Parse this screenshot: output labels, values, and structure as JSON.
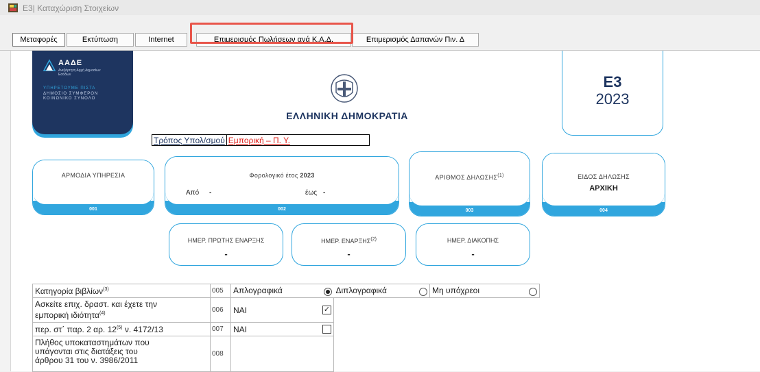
{
  "window": {
    "title": "Ε3| Καταχώριση Στοιχείων"
  },
  "toolbar": {
    "buttons": [
      "Μεταφορές",
      "Εκτύπωση",
      "Internet",
      "Επιμερισμός Πωλήσεων ανά Κ.Α.Δ.",
      "Επιμερισμός Δαπανών Πιν. Δ"
    ]
  },
  "logo": {
    "brand": "ΑΑΔΕ",
    "brand_sub": "Ανεξάρτητη Αρχή Δημοσίων Εσόδων",
    "motto_1": "ΥΠΗΡΕΤΟΥΜΕ ΠΙΣΤΑ",
    "motto_2": "ΔΗΜΟΣΙΟ ΣΥΜΦΕΡΟΝ ΚΟΙΝΩΝΙΚΟ ΣΥΝΟΛΟ"
  },
  "header": {
    "republic": "ΕΛΛΗΝΙΚΗ ΔΗΜΟΚΡΑΤΙΑ",
    "form": "Ε3",
    "year": "2023"
  },
  "calc": {
    "label": "Τρόπος Υπολ/σμού",
    "value": "Εμπορική – Π. Υ."
  },
  "fields": {
    "service": {
      "title": "ΑΡΜΟΔΙΑ ΥΠΗΡΕΣΙΑ",
      "code": "001"
    },
    "tax_year": {
      "title_prefix": "Φορολογικό έτος",
      "year": "2023",
      "from_label": "Από",
      "from_value": "-",
      "to_label": "έως",
      "to_value": "-",
      "code": "002"
    },
    "decl_no": {
      "title": "ΑΡΙΘΜΟΣ ΔΗΛΩΣΗΣ",
      "sup": "(1)",
      "code": "003"
    },
    "decl_type": {
      "title": "ΕΙΔΟΣ ΔΗΛΩΣΗΣ",
      "value": "ΑΡΧΙΚΗ",
      "code": "004"
    }
  },
  "dates": {
    "first_start": {
      "title": "ΗΜΕΡ. ΠΡΩΤΗΣ ΕΝΑΡΞΗΣ",
      "value": "-"
    },
    "start": {
      "title": "ΗΜΕΡ. ΕΝΑΡΞΗΣ",
      "sup": "(2)",
      "value": "-"
    },
    "stop": {
      "title": "ΗΜΕΡ. ΔΙΑΚΟΠΗΣ",
      "value": "-"
    }
  },
  "books": {
    "label": "Κατηγορία βιβλίων",
    "sup": "(3)",
    "code": "005",
    "options": [
      "Απλογραφικά",
      "Διπλογραφικά",
      "Μη υπόχρεοι"
    ],
    "selected": 0
  },
  "row006": {
    "label_1": "Ασκείτε επιχ. δραστ. και έχετε την",
    "label_2": "εμπορική ιδιότητα",
    "sup": "(4)",
    "code": "006",
    "value": "ΝΑΙ",
    "checked": true
  },
  "row007": {
    "label_pre": "περ. στ΄ παρ. 2 αρ. 12",
    "sup": "(5)",
    "label_post": " ν. 4172/13",
    "code": "007",
    "value": "ΝΑΙ",
    "checked": false
  },
  "row008": {
    "label_1": "Πλήθος υποκαταστημάτων που",
    "label_2": "υπάγονται στις διατάξεις του",
    "label_3": "άρθρου 31 του ν. 3986/2011",
    "code": "008"
  },
  "colors": {
    "accent": "#31a6de",
    "navy": "#1e3560",
    "highlight": "#e8554a",
    "red": "#e0201a"
  }
}
